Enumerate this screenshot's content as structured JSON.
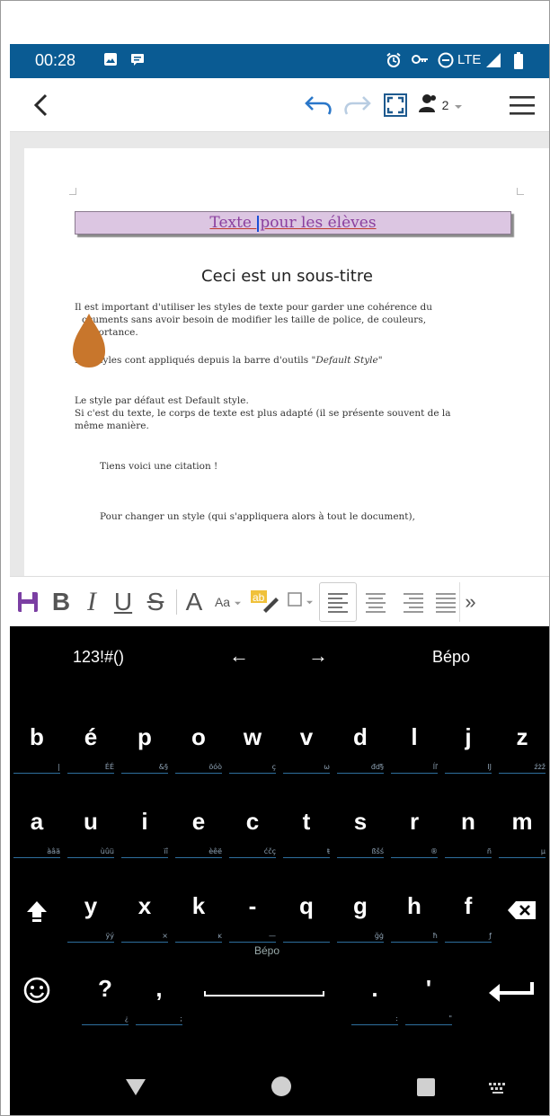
{
  "status_bar": {
    "time": "00:28",
    "network": "LTE",
    "icons": [
      "image-icon",
      "message-icon",
      "alarm-icon",
      "vpn-key-icon",
      "do-not-disturb-icon",
      "signal-icon",
      "battery-icon"
    ]
  },
  "toolbar": {
    "users_count": "2",
    "icons": [
      "back-icon",
      "undo-icon",
      "redo-icon",
      "fullscreen-icon",
      "users-icon",
      "dropdown-icon",
      "menu-icon"
    ]
  },
  "document": {
    "heading": [
      "Texte ",
      "pour les élèves"
    ],
    "subtitle": "Ceci est un sous-titre",
    "paragraph1": [
      "I",
      "l est important d'utiliser les styles de texte pour garder une cohérence du",
      "ocuments sans avoir besoin de modifier les taille de police, de couleurs,",
      "mportance."
    ],
    "paragraph2_prefix": "Les  styles cont appliqués depuis la barre d'outils \"",
    "paragraph2_style": "Default Style",
    "paragraph2_suffix": "\"",
    "paragraph3": [
      "Le style par défaut est Default style.",
      "Si c'est du texte, le corps de texte est plus adapté (il se présente souvent de la",
      "même manière."
    ],
    "quote": "Tiens voici une citation  !",
    "paragraph4": "Pour changer un style (qui s'appliquera alors à tout le document),"
  },
  "format_toolbar": {
    "items": [
      "save-icon",
      "bold-icon",
      "italic-icon",
      "underline-icon",
      "strikethrough-icon",
      "font-size-icon",
      "case-icon",
      "highlight-icon",
      "border-icon",
      "align-left-icon",
      "align-center-icon",
      "align-right-icon",
      "justify-icon",
      "more-icon"
    ],
    "font_letter": "A",
    "case_label": "Aa",
    "highlight_label": "ab",
    "more_label": "»"
  },
  "keyboard": {
    "suggestions": [
      "123!#()",
      "←",
      "→",
      "Bépo"
    ],
    "rows": [
      [
        {
          "main": "b",
          "sub": "|"
        },
        {
          "main": "é",
          "sub": "ÉÉ"
        },
        {
          "main": "p",
          "sub": "&§"
        },
        {
          "main": "o",
          "sub": "öóò"
        },
        {
          "main": "w",
          "sub": "ç"
        },
        {
          "main": "v",
          "sub": "ω"
        },
        {
          "main": "d",
          "sub": "đď§"
        },
        {
          "main": "l",
          "sub": "ĺľ"
        },
        {
          "main": "j",
          "sub": "Ĳ"
        },
        {
          "main": "z",
          "sub": "źżž"
        }
      ],
      [
        {
          "main": "a",
          "sub": "àâä"
        },
        {
          "main": "u",
          "sub": "ùûü"
        },
        {
          "main": "i",
          "sub": "ïî"
        },
        {
          "main": "e",
          "sub": "èêë"
        },
        {
          "main": "c",
          "sub": "ćčç"
        },
        {
          "main": "t",
          "sub": "ŧ"
        },
        {
          "main": "s",
          "sub": "ßšś"
        },
        {
          "main": "r",
          "sub": "®"
        },
        {
          "main": "n",
          "sub": "ñ"
        },
        {
          "main": "m",
          "sub": "µ"
        }
      ],
      [
        {
          "main": "",
          "sub": "",
          "icon": "shift-icon"
        },
        {
          "main": "y",
          "sub": "ÿý"
        },
        {
          "main": "x",
          "sub": "×"
        },
        {
          "main": "k",
          "sub": "ĸ"
        },
        {
          "main": "-",
          "sub": "—"
        },
        {
          "main": "q",
          "sub": ""
        },
        {
          "main": "g",
          "sub": "ğġ"
        },
        {
          "main": "h",
          "sub": "ħ"
        },
        {
          "main": "f",
          "sub": "ƒ"
        },
        {
          "main": "",
          "sub": "",
          "icon": "backspace-icon"
        }
      ],
      [
        {
          "main": "",
          "sub": "",
          "icon": "emoji-icon"
        },
        {
          "main": "?",
          "sub": "¿"
        },
        {
          "main": ",",
          "sub": ";"
        },
        {
          "main": "",
          "sub": "",
          "space": true
        },
        {
          "main": ".",
          "sub": ":"
        },
        {
          "main": "'",
          "sub": "\""
        },
        {
          "main": "",
          "sub": "",
          "icon": "enter-icon"
        }
      ]
    ],
    "space_label": "Bépo"
  },
  "navbar": {
    "icons": [
      "nav-back-icon",
      "nav-home-icon",
      "nav-recents-icon",
      "keyboard-switch-icon"
    ]
  },
  "colors": {
    "status_bar": "#0a5b93",
    "heading_bg": "#dcc6e2",
    "heading_text": "#8a3f9e",
    "accent_blue": "#2a77c9",
    "keyboard_bg": "#000000",
    "drop_handle": "#c8762c"
  }
}
